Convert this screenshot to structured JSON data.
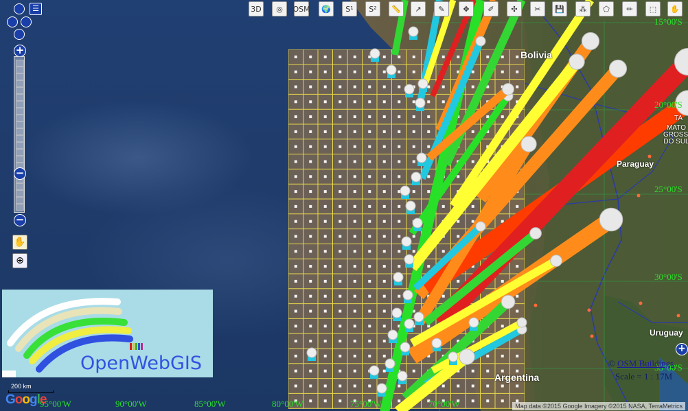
{
  "map": {
    "lat_labels": [
      "15°00'S",
      "20°00'S",
      "25°00'S",
      "30°00'S",
      "35°00'S"
    ],
    "lon_labels": [
      "95°00'W",
      "90°00'W",
      "85°00'W",
      "80°00'W",
      "75°00'W",
      "70°00'W"
    ],
    "countries": [
      "Bolivia",
      "Paraguay",
      "Uruguay",
      "Argentina"
    ],
    "region_label": "MATO GROSSO DO SUL",
    "region_top": "TA",
    "colors": {
      "grid": "#e8d84a",
      "lat_lon_text": "#28e028",
      "ocean": "#1f3c6c",
      "land": "#5a5b3e"
    }
  },
  "toolbar": {
    "buttons": [
      {
        "icon": "3d-icon",
        "label": "3D"
      },
      {
        "icon": "target-icon",
        "label": ""
      },
      {
        "icon": "osm-icon",
        "label": "OSM"
      },
      {
        "icon": "globe-icon",
        "label": ""
      },
      {
        "icon": "s1-icon",
        "label": "S¹"
      },
      {
        "icon": "s2-icon",
        "label": "S²"
      },
      {
        "icon": "ruler-icon",
        "label": ""
      },
      {
        "icon": "route-icon",
        "label": ""
      },
      {
        "icon": "pencil-icon",
        "label": ""
      },
      {
        "icon": "move-icon",
        "label": ""
      },
      {
        "icon": "edit-icon",
        "label": ""
      },
      {
        "icon": "move-node-icon",
        "label": ""
      },
      {
        "icon": "delete-icon",
        "label": ""
      },
      {
        "icon": "save-icon",
        "label": ""
      },
      {
        "icon": "nodes-icon",
        "label": ""
      },
      {
        "icon": "polygon-icon",
        "label": ""
      },
      {
        "icon": "draw-icon",
        "label": ""
      },
      {
        "icon": "select-box-icon",
        "label": ""
      },
      {
        "icon": "pan-icon",
        "label": ""
      }
    ]
  },
  "nav": {
    "zoom_in": "+",
    "zoom_out": "−",
    "zoom_out2": "−"
  },
  "logo": {
    "name": "OpenWebGIS"
  },
  "scale_bar": {
    "label": "200 km"
  },
  "google": {
    "letters": [
      "G",
      "o",
      "o",
      "g",
      "l",
      "e"
    ],
    "colors": [
      "#4285f4",
      "#ea4335",
      "#fbbc05",
      "#4285f4",
      "#34a853",
      "#ea4335"
    ]
  },
  "attribution": "Map data ©2015 Google Imagery ©2015 NASA, TerraMetrics",
  "osm_credit": {
    "prefix": "©",
    "link": "OSM Buildings"
  },
  "scale_text": "Scale = 1 : 17M",
  "plus_button": "+"
}
